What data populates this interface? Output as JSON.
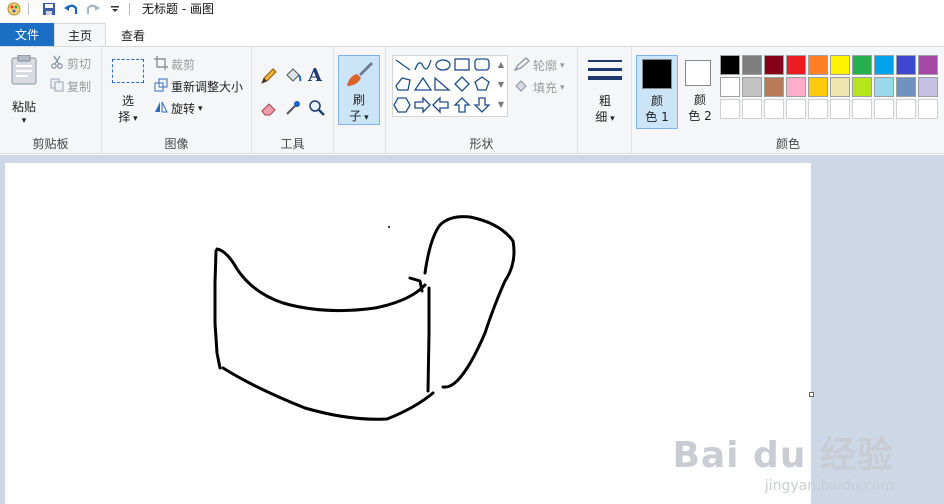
{
  "window": {
    "title": "无标题 - 画图"
  },
  "tabs": {
    "file": "文件",
    "home": "主页",
    "view": "查看"
  },
  "clipboard": {
    "paste": "粘贴",
    "cut": "剪切",
    "copy": "复制",
    "label": "剪贴板"
  },
  "image": {
    "select_line1": "选",
    "select_line2": "择",
    "crop": "裁剪",
    "resize": "重新调整大小",
    "rotate": "旋转",
    "label": "图像"
  },
  "tools": {
    "label": "工具"
  },
  "brushes": {
    "line1": "刷",
    "line2": "子"
  },
  "shapes": {
    "outline": "轮廓",
    "fill": "填充",
    "label": "形状"
  },
  "size": {
    "line1": "粗",
    "line2": "细"
  },
  "colors": {
    "color1_line1": "颜",
    "color1_line2": "色 1",
    "color2_line1": "颜",
    "color2_line2": "色 2",
    "label": "颜色",
    "color1": "#000000",
    "color2": "#ffffff",
    "palette_row1": [
      "#000000",
      "#7f7f7f",
      "#880015",
      "#ed1c24",
      "#ff7f27",
      "#fff200",
      "#22b14c",
      "#00a2e8",
      "#3f48cc",
      "#a349a4"
    ],
    "palette_row2": [
      "#ffffff",
      "#c3c3c3",
      "#b97a57",
      "#ffaec9",
      "#ffc90e",
      "#efe4b0",
      "#b5e61d",
      "#99d9ea",
      "#7092be",
      "#c8bfe7"
    ]
  },
  "watermark": {
    "brand": "Bai du 经验",
    "url": "jingyan.baidu.com"
  }
}
